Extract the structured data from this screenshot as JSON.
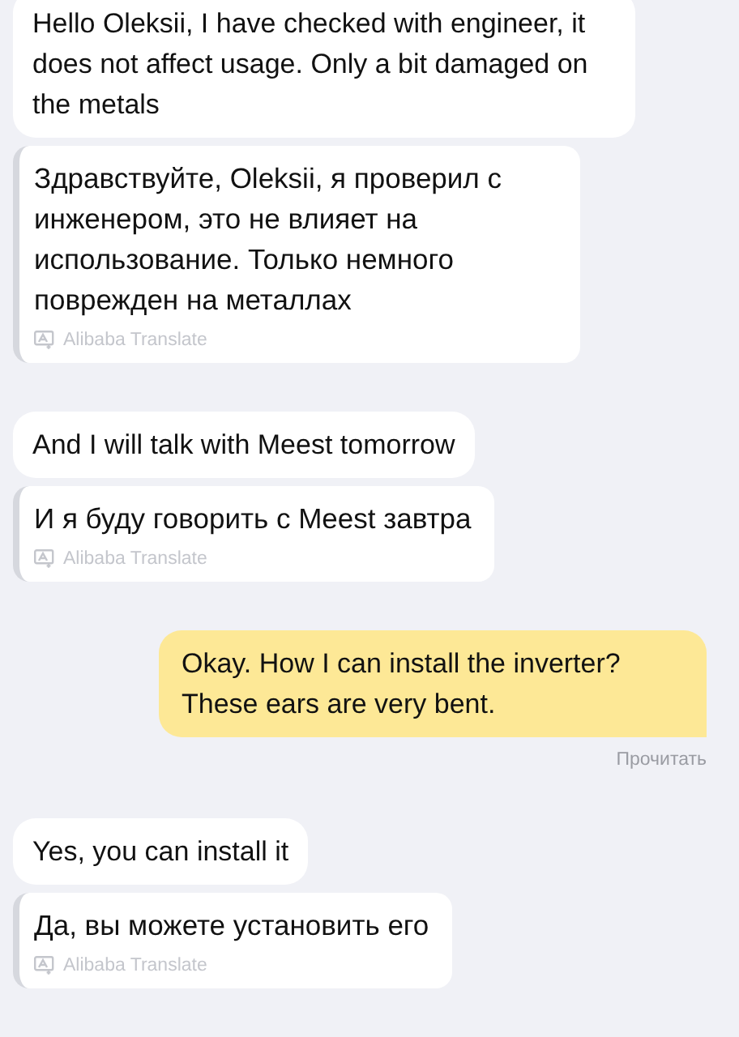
{
  "messages": [
    {
      "kind": "incoming",
      "text": "Hello Oleksii, I have checked with engineer, it does not affect usage. Only a bit damaged on the metals",
      "translation": "Здравствуйте, Oleksii, я проверил с инженером, это не влияет на использование. Только немного поврежден на металлах",
      "translator": "Alibaba Translate"
    },
    {
      "kind": "incoming",
      "text": "And I will talk with Meest tomorrow",
      "translation": "И я буду говорить с Meest завтра",
      "translator": "Alibaba Translate"
    },
    {
      "kind": "outgoing",
      "text": "Okay. How I can install the inverter? These ears are very bent.",
      "status": "Прочитать"
    },
    {
      "kind": "incoming",
      "text": "Yes, you can install it",
      "translation": "Да, вы можете установить его",
      "translator": "Alibaba Translate"
    }
  ]
}
